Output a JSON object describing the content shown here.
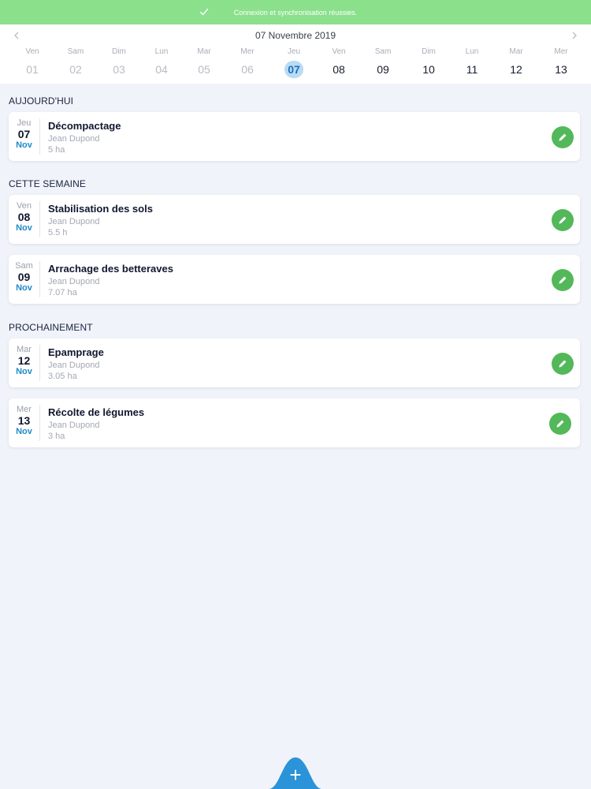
{
  "banner": {
    "message": "Connexion et synchronisation réussies."
  },
  "calendar": {
    "title": "07 Novembre 2019",
    "days": [
      {
        "name": "Ven",
        "num": "01"
      },
      {
        "name": "Sam",
        "num": "02"
      },
      {
        "name": "Dim",
        "num": "03"
      },
      {
        "name": "Lun",
        "num": "04"
      },
      {
        "name": "Mar",
        "num": "05"
      },
      {
        "name": "Mer",
        "num": "06"
      },
      {
        "name": "Jeu",
        "num": "07"
      },
      {
        "name": "Ven",
        "num": "08"
      },
      {
        "name": "Sam",
        "num": "09"
      },
      {
        "name": "Dim",
        "num": "10"
      },
      {
        "name": "Lun",
        "num": "11"
      },
      {
        "name": "Mar",
        "num": "12"
      },
      {
        "name": "Mer",
        "num": "13"
      }
    ],
    "selected_index": 6
  },
  "sections": [
    {
      "title": "AUJOURD'HUI",
      "tasks": [
        {
          "dow": "Jeu",
          "day": "07",
          "month": "Nov",
          "title": "Décompactage",
          "person": "Jean Dupond",
          "amount": "5 ha"
        }
      ]
    },
    {
      "title": "CETTE SEMAINE",
      "tasks": [
        {
          "dow": "Ven",
          "day": "08",
          "month": "Nov",
          "title": "Stabilisation des sols",
          "person": "Jean Dupond",
          "amount": "5.5 h"
        },
        {
          "dow": "Sam",
          "day": "09",
          "month": "Nov",
          "title": "Arrachage des betteraves",
          "person": "Jean Dupond",
          "amount": "7.07 ha"
        }
      ]
    },
    {
      "title": "PROCHAINEMENT",
      "tasks": [
        {
          "dow": "Mar",
          "day": "12",
          "month": "Nov",
          "title": "Epamprage",
          "person": "Jean Dupond",
          "amount": "3.05 ha"
        },
        {
          "dow": "Mer",
          "day": "13",
          "month": "Nov",
          "title": "Récolte de légumes",
          "person": "Jean Dupond",
          "amount": "3 ha"
        }
      ]
    }
  ],
  "icons": {
    "sync": "check-icon",
    "prev": "chevron-left-icon",
    "next": "chevron-right-icon",
    "edit": "pencil-icon",
    "add": "plus-icon"
  },
  "colors": {
    "banner": "#8be08b",
    "selected_day": "#b9dbf3",
    "month_accent": "#1f8ac9",
    "edit_button": "#53b85a",
    "fab": "#2b93d8"
  }
}
